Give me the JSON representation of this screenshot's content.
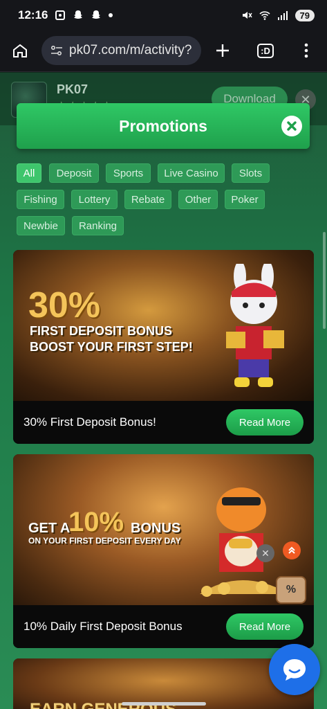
{
  "status": {
    "time": "12:16",
    "battery": "79"
  },
  "browser": {
    "url": "pk07.com/m/activity?",
    "tab_count": ":D"
  },
  "app_banner": {
    "name": "PK07",
    "stars": "★★★★★",
    "download_label": "Download"
  },
  "promotions": {
    "title": "Promotions",
    "filters": [
      {
        "label": "All",
        "active": true
      },
      {
        "label": "Deposit"
      },
      {
        "label": "Sports"
      },
      {
        "label": "Live Casino"
      },
      {
        "label": "Slots"
      },
      {
        "label": "Fishing"
      },
      {
        "label": "Lottery"
      },
      {
        "label": "Rebate"
      },
      {
        "label": "Other"
      },
      {
        "label": "Poker"
      },
      {
        "label": "Newbie"
      },
      {
        "label": "Ranking"
      }
    ],
    "cards": [
      {
        "title": "30% First Deposit Bonus!",
        "read_more": "Read More",
        "hero_big": "30%",
        "hero_line1": "FIRST DEPOSIT BONUS",
        "hero_line2": "BOOST YOUR FIRST STEP!"
      },
      {
        "title": "10% Daily First Deposit Bonus",
        "read_more": "Read More",
        "hero_pre": "GET A",
        "hero_big": "10%",
        "hero_post": "BONUS",
        "hero_sub": "ON YOUR FIRST DEPOSIT EVERY DAY"
      },
      {
        "hero_big": "EARN GENEROUS"
      }
    ]
  },
  "colors": {
    "accent": "#2fc865",
    "chat": "#1e6fe8"
  }
}
